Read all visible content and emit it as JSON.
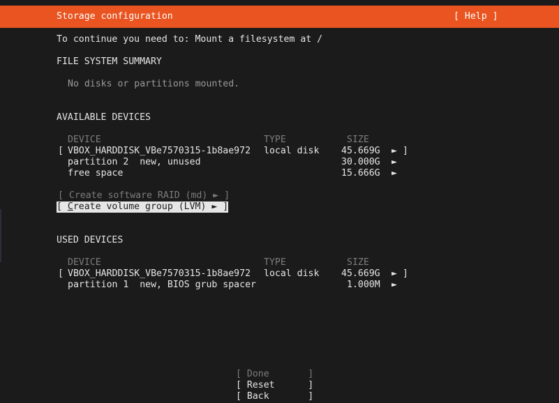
{
  "header": {
    "title": "Storage configuration",
    "help": "[ Help ]"
  },
  "instruction": "To continue you need to: Mount a filesystem at /",
  "summary": {
    "heading": "FILE SYSTEM SUMMARY",
    "empty_text": "No disks or partitions mounted."
  },
  "available": {
    "heading": "AVAILABLE DEVICES",
    "columns": {
      "device": "DEVICE",
      "type": "TYPE",
      "size": "SIZE"
    },
    "disk": {
      "open": "[",
      "name": "VBOX_HARDDISK_VBe7570315-1b8ae972",
      "type": "local disk",
      "size": "45.669G",
      "arrow": "►",
      "close": "]"
    },
    "partition": {
      "label": "partition 2  new, unused",
      "size": "30.000G",
      "arrow": "►"
    },
    "free": {
      "label": "free space",
      "size": "15.666G",
      "arrow": "►"
    }
  },
  "actions": {
    "raid": "[ Create software RAID (md) ► ]",
    "lvm_prefix": "[ ",
    "lvm_hotkey": "C",
    "lvm_rest": "reate volume group (LVM) ► ]"
  },
  "used": {
    "heading": "USED DEVICES",
    "columns": {
      "device": "DEVICE",
      "type": "TYPE",
      "size": "SIZE"
    },
    "disk": {
      "open": "[",
      "name": "VBOX_HARDDISK_VBe7570315-1b8ae972",
      "type": "local disk",
      "size": "45.669G",
      "arrow": "►",
      "close": "]"
    },
    "partition": {
      "label": "partition 1  new, BIOS grub spacer",
      "size": "1.000M",
      "arrow": "►"
    }
  },
  "buttons": {
    "done": "[ Done       ]",
    "reset": "[ Reset      ]",
    "back": "[ Back       ]"
  },
  "colors": {
    "header_bg": "#e95420",
    "background": "#1b1b1b",
    "text": "#e6e6e6",
    "dim": "#7d7d7d"
  }
}
